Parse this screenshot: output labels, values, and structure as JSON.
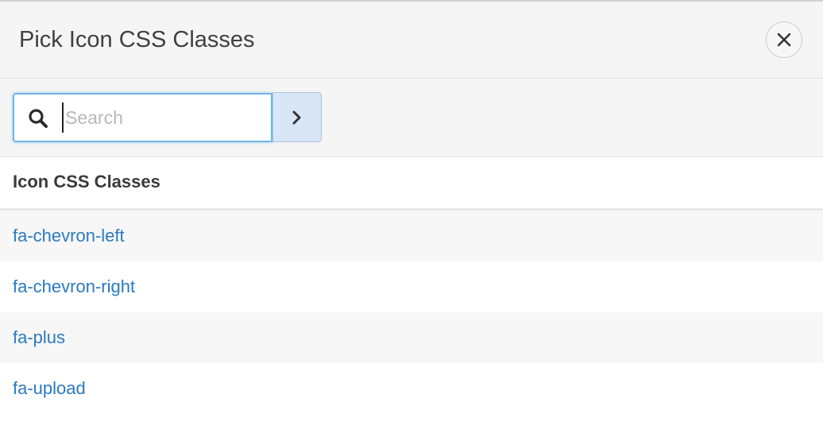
{
  "dialog": {
    "title": "Pick Icon CSS Classes",
    "close_icon": "close-icon"
  },
  "search": {
    "placeholder": "Search",
    "value": "",
    "search_icon": "search-icon",
    "go_icon": "chevron-right-icon"
  },
  "list": {
    "header": "Icon CSS Classes",
    "items": [
      {
        "label": "fa-chevron-left"
      },
      {
        "label": "fa-chevron-right"
      },
      {
        "label": "fa-plus"
      },
      {
        "label": "fa-upload"
      }
    ]
  },
  "colors": {
    "link": "#2a7ac0",
    "focus_border": "#6fb6e8",
    "go_button_bg": "#d9e6f5"
  }
}
